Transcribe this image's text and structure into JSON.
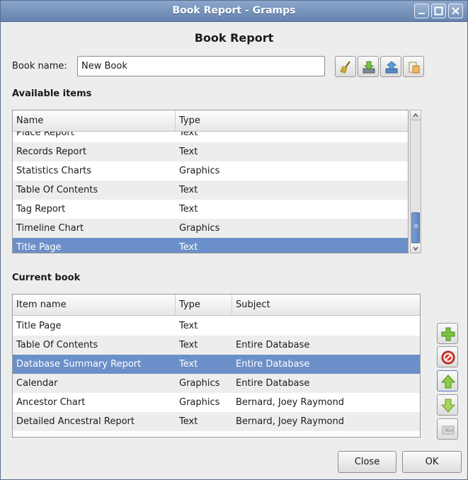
{
  "window": {
    "title": "Book Report - Gramps"
  },
  "dialog": {
    "heading": "Book Report"
  },
  "book_name": {
    "label": "Book name:",
    "value": "New Book"
  },
  "available": {
    "label": "Available items",
    "columns": [
      "Name",
      "Type"
    ],
    "rows": [
      {
        "name": "Place Report",
        "type": "Text"
      },
      {
        "name": "Records Report",
        "type": "Text"
      },
      {
        "name": "Statistics Charts",
        "type": "Graphics"
      },
      {
        "name": "Table Of Contents",
        "type": "Text"
      },
      {
        "name": "Tag Report",
        "type": "Text"
      },
      {
        "name": "Timeline Chart",
        "type": "Graphics"
      },
      {
        "name": "Title Page",
        "type": "Text"
      }
    ],
    "selected": "Title Page"
  },
  "current": {
    "label": "Current book",
    "columns": [
      "Item name",
      "Type",
      "Subject"
    ],
    "rows": [
      {
        "name": "Title Page",
        "type": "Text",
        "subject": ""
      },
      {
        "name": "Table Of Contents",
        "type": "Text",
        "subject": "Entire Database"
      },
      {
        "name": "Database Summary Report",
        "type": "Text",
        "subject": "Entire Database"
      },
      {
        "name": "Calendar",
        "type": "Graphics",
        "subject": "Entire Database"
      },
      {
        "name": "Ancestor Chart",
        "type": "Graphics",
        "subject": "Bernard, Joey Raymond"
      },
      {
        "name": "Detailed Ancestral Report",
        "type": "Text",
        "subject": "Bernard, Joey Raymond"
      }
    ],
    "selected": "Database Summary Report"
  },
  "toolbar_icons": [
    "clear-book-icon",
    "save-book-icon",
    "open-book-icon",
    "edit-books-icon"
  ],
  "side_icons": [
    "add-item-icon",
    "remove-item-icon",
    "move-up-icon",
    "move-down-icon",
    "setup-item-icon"
  ],
  "buttons": {
    "close": "Close",
    "ok": "OK"
  },
  "colors": {
    "selection": "#6b8fc8",
    "titlebar": "#7391bb"
  }
}
